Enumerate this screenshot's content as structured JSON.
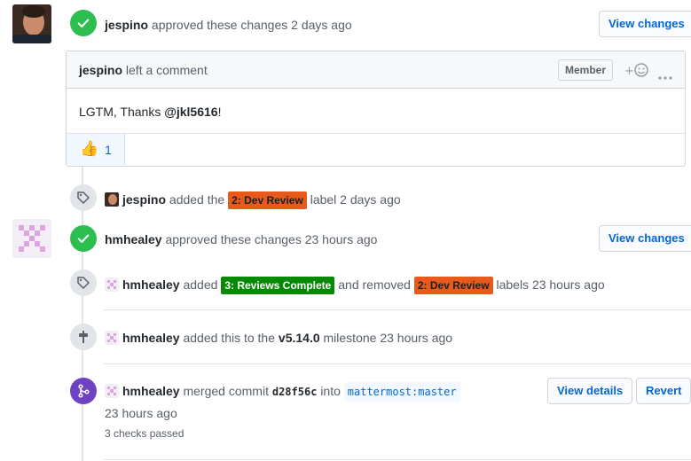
{
  "colors": {
    "approved": "#2cbe4e",
    "merged": "#6f42c1",
    "link": "#0366d6",
    "label_dev_review": "#e75a1c",
    "label_reviews_complete": "#068a04"
  },
  "review1": {
    "author": "jespino",
    "action": "approved these changes",
    "time": "2 days ago",
    "button": "View changes",
    "icon": "check-icon"
  },
  "comment": {
    "author": "jespino",
    "action": "left a comment",
    "role": "Member",
    "body_prefix": "LGTM, Thanks ",
    "mention": "@jkl5616",
    "body_suffix": "!",
    "reaction_emoji": "👍",
    "reaction_count": "1"
  },
  "event_label1": {
    "author": "jespino",
    "text1": "added the",
    "label": "2: Dev Review",
    "text2": "label 2 days ago",
    "icon": "tag-icon"
  },
  "review2": {
    "author": "hmhealey",
    "action": "approved these changes",
    "time": "23 hours ago",
    "button": "View changes",
    "icon": "check-icon"
  },
  "event_labels2": {
    "author": "hmhealey",
    "text1": "added",
    "label_added": "3: Reviews Complete",
    "text2": "and removed",
    "label_removed": "2: Dev Review",
    "text3": "labels 23 hours ago",
    "icon": "tag-icon"
  },
  "event_milestone": {
    "author": "hmhealey",
    "text1": "added this to the",
    "milestone": "v5.14.0",
    "text2": "milestone 23 hours ago",
    "icon": "milestone-icon"
  },
  "merge": {
    "author": "hmhealey",
    "text1": "merged commit",
    "sha": "d28f56c",
    "text2": "into",
    "branch": "mattermost:master",
    "time": "23 hours ago",
    "checks": "3 checks passed",
    "view_details": "View details",
    "revert": "Revert",
    "icon": "git-merge-icon"
  }
}
